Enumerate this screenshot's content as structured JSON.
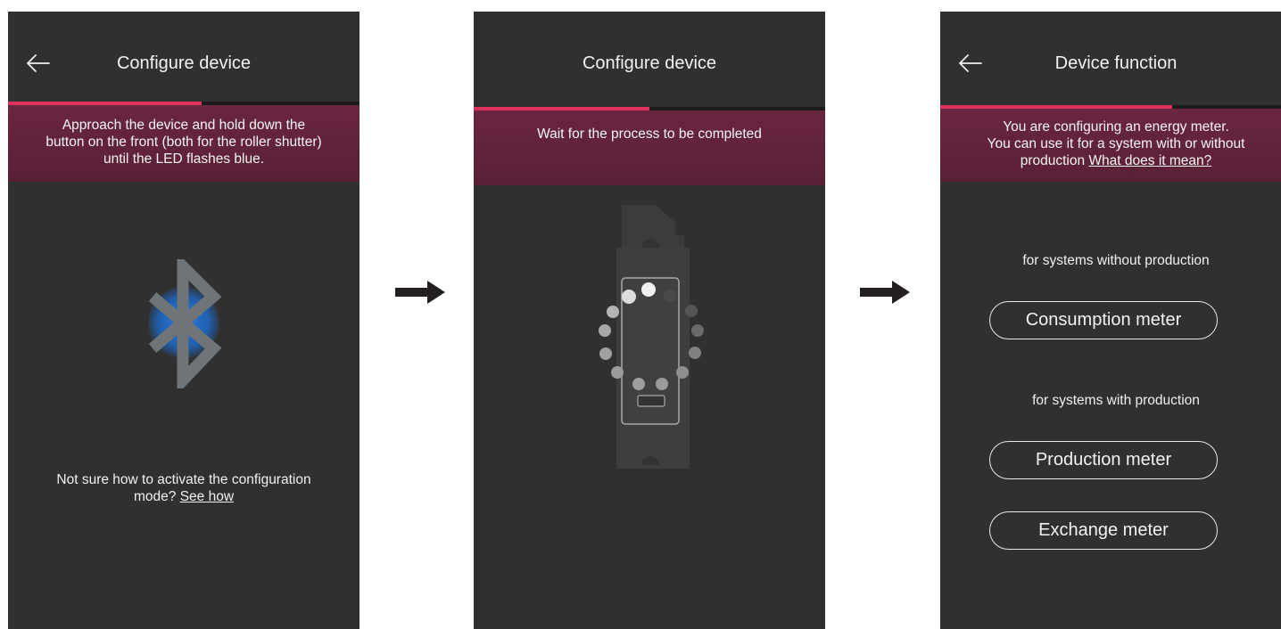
{
  "screen1": {
    "title": "Configure device",
    "progress": 0.55,
    "instruction_line1": "Approach the device and hold down the",
    "instruction_line2": "button on the front (both for the roller shutter)",
    "instruction_line3": "until the LED flashes blue.",
    "help_line1": "Not sure how to activate the configuration",
    "help_prefix": "mode? ",
    "help_link": "See how",
    "icon": "bluetooth-icon"
  },
  "screen2": {
    "title": "Configure device",
    "progress": 0.5,
    "status": "Wait for the process to be completed",
    "icon": "loading-spinner"
  },
  "screen3": {
    "title": "Device function",
    "progress": 0.66,
    "info_line1": "You are configuring an energy meter.",
    "info_line2": "You can use it for a system with or without",
    "info_prefix": "production ",
    "info_link": "What does it mean?",
    "section_without": "for systems without production",
    "btn_consumption": "Consumption meter",
    "section_with": "for systems with production",
    "btn_production": "Production meter",
    "btn_exchange": "Exchange meter"
  },
  "colors": {
    "screen_bg": "#303030",
    "banner_bg": "#5e2139",
    "progress_accent": "#e0315c",
    "bluetooth_blue": "#1f5fae",
    "arrow": "#231f20"
  }
}
